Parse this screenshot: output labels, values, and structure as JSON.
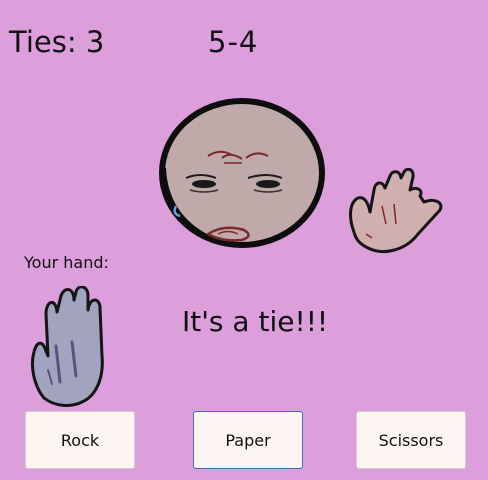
{
  "scoreboard": {
    "ties_text": "Ties: 3",
    "score_text": "5-4"
  },
  "opponent": {
    "face_icon": "sad-face-icon",
    "hand_icon": "open-hand-icon",
    "hand_choice": "paper"
  },
  "player": {
    "hand_label": "Your hand:",
    "hand_icon": "open-hand-icon",
    "hand_choice": "paper"
  },
  "result_text": "It's a tie!!!",
  "buttons": {
    "rock": "Rock",
    "paper": "Paper",
    "scissors": "Scissors",
    "selected": "paper"
  },
  "colors": {
    "background": "#dd9edc",
    "button_bg": "#fcf5f1",
    "selected_border": "#3d6fc4",
    "face_fill": "#bfa9a9",
    "opponent_hand_fill": "#cfb0ae",
    "player_hand_fill": "#a1a3bf"
  }
}
